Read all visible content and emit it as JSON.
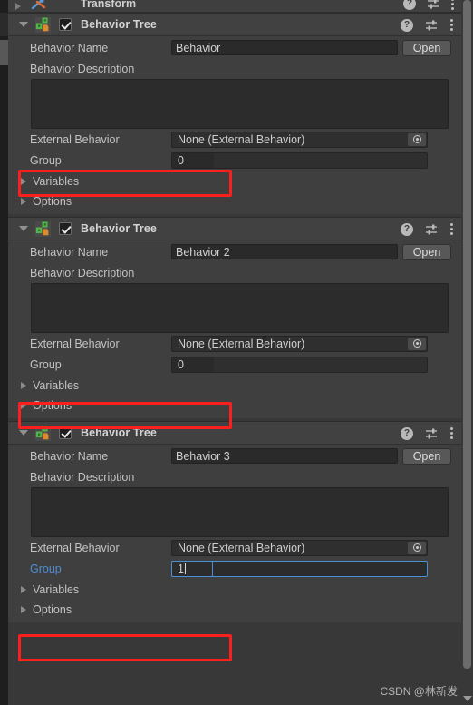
{
  "window": {
    "background_color": "#383838",
    "panel_color": "#3f3f3f",
    "header_color": "#414141",
    "accent_blue": "#4b8fd4",
    "annotation_red": "#fb2020"
  },
  "transform_component": {
    "title": "Transform",
    "icon": "transform-icon",
    "foldout_icon": "chevron-right-icon",
    "help_icon": "help-icon",
    "preset_icon": "preset-icon",
    "menu_icon": "kebab-menu-icon"
  },
  "header_icons": {
    "help_label": "?",
    "help_icon": "help-icon",
    "preset_icon": "preset-icon",
    "menu_icon": "kebab-menu-icon"
  },
  "labels": {
    "behavior_name": "Behavior Name",
    "behavior_description": "Behavior Description",
    "external_behavior": "External Behavior",
    "group": "Group",
    "variables": "Variables",
    "options": "Options",
    "open_button": "Open"
  },
  "components": [
    {
      "title": "Behavior Tree",
      "enabled": true,
      "expanded": true,
      "behavior_name": "Behavior",
      "behavior_description": "",
      "external_behavior": "None (External Behavior)",
      "group_value": "0",
      "group_editing": false,
      "variables_expanded": false,
      "options_expanded": false,
      "highlighted": true
    },
    {
      "title": "Behavior Tree",
      "enabled": true,
      "expanded": true,
      "behavior_name": "Behavior 2",
      "behavior_description": "",
      "external_behavior": "None (External Behavior)",
      "group_value": "0",
      "group_editing": false,
      "variables_expanded": false,
      "options_expanded": false,
      "highlighted": true
    },
    {
      "title": "Behavior Tree",
      "enabled": true,
      "expanded": true,
      "behavior_name": "Behavior 3",
      "behavior_description": "",
      "external_behavior": "None (External Behavior)",
      "group_value": "1",
      "group_editing": true,
      "variables_expanded": false,
      "options_expanded": false,
      "highlighted": true
    }
  ],
  "scrollbar": {
    "orientation": "vertical",
    "down_arrow_icon": "chevron-down-icon"
  },
  "watermark": {
    "text": "CSDN @林新发"
  }
}
